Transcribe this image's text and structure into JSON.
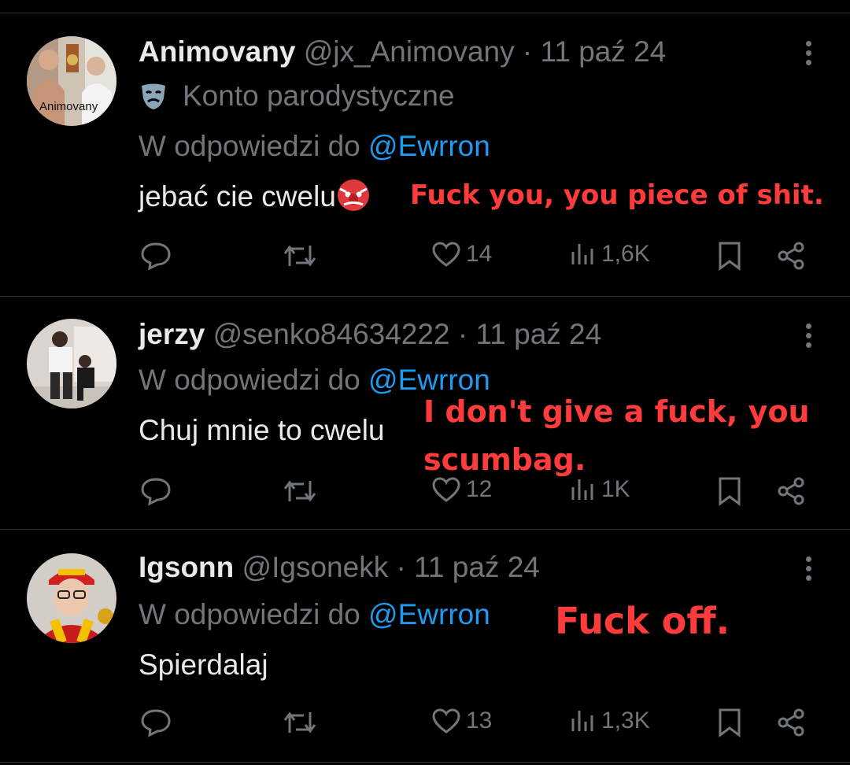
{
  "reply_prefix": "W odpowiedzi do",
  "reply_to": "@Ewrron",
  "tweets": [
    {
      "name": "Animovany",
      "handle": "@jx_Animovany",
      "separator": "·",
      "date": "11 paź 24",
      "parody_label": "Konto parodystyczne",
      "avatar_text": "Animovany",
      "text": "jebać cie cwelu",
      "emoji": "goblin-emoji",
      "likes": "14",
      "views": "1,6K",
      "translation": "Fuck you, you piece of shit."
    },
    {
      "name": "jerzy",
      "handle": "@senko84634222",
      "separator": "·",
      "date": "11 paź 24",
      "text": "Chuj mnie to cwelu",
      "likes": "12",
      "views": "1K",
      "translation_line1": "I don't give a fuck, you",
      "translation_line2": "scumbag."
    },
    {
      "name": "Igsonn",
      "handle": "@Igsonekk",
      "separator": "·",
      "date": "11 paź 24",
      "text": "Spierdalaj",
      "likes": "13",
      "views": "1,3K",
      "translation": "Fuck off."
    }
  ],
  "colors": {
    "background": "#000000",
    "text": "#e7e9ea",
    "secondary": "#71767b",
    "link": "#1d9bf0",
    "overlay": "#ff3b3b",
    "divider": "#2f3336"
  }
}
